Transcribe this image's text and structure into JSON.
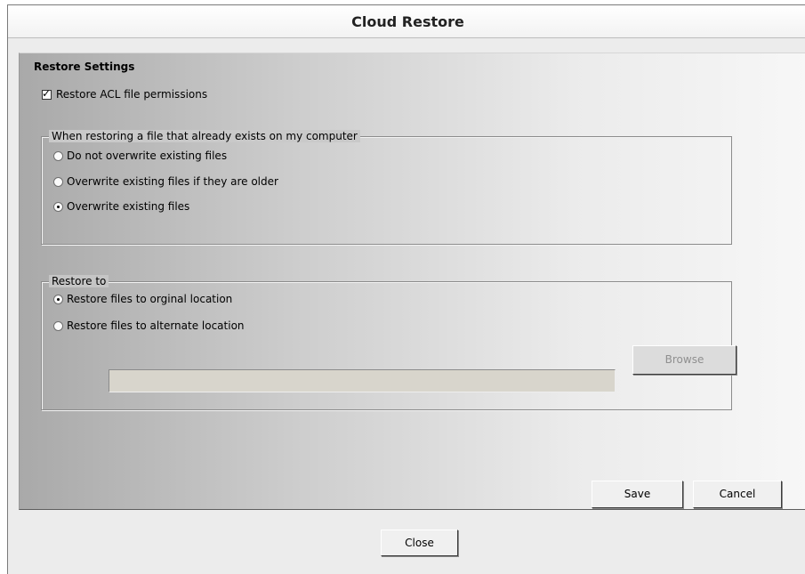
{
  "window": {
    "title": "Cloud Restore"
  },
  "settings": {
    "title": "Restore Settings",
    "acl_checkbox": {
      "label": "Restore ACL file permissions",
      "checked": true
    }
  },
  "overwrite_group": {
    "legend": "When restoring a file that already exists on my computer",
    "options": [
      {
        "label": "Do not overwrite existing files",
        "selected": false
      },
      {
        "label": "Overwrite existing files if they are older",
        "selected": false
      },
      {
        "label": "Overwrite existing files",
        "selected": true
      }
    ]
  },
  "restore_to_group": {
    "legend": "Restore to",
    "options": [
      {
        "label": "Restore files to orginal location",
        "selected": true
      },
      {
        "label": "Restore files to alternate location",
        "selected": false
      }
    ],
    "path_input": {
      "value": ""
    },
    "browse_label": "Browse"
  },
  "actions": {
    "save_label": "Save",
    "cancel_label": "Cancel",
    "close_label": "Close"
  },
  "icons": {
    "checkbox_tick": "checkmark-icon"
  }
}
